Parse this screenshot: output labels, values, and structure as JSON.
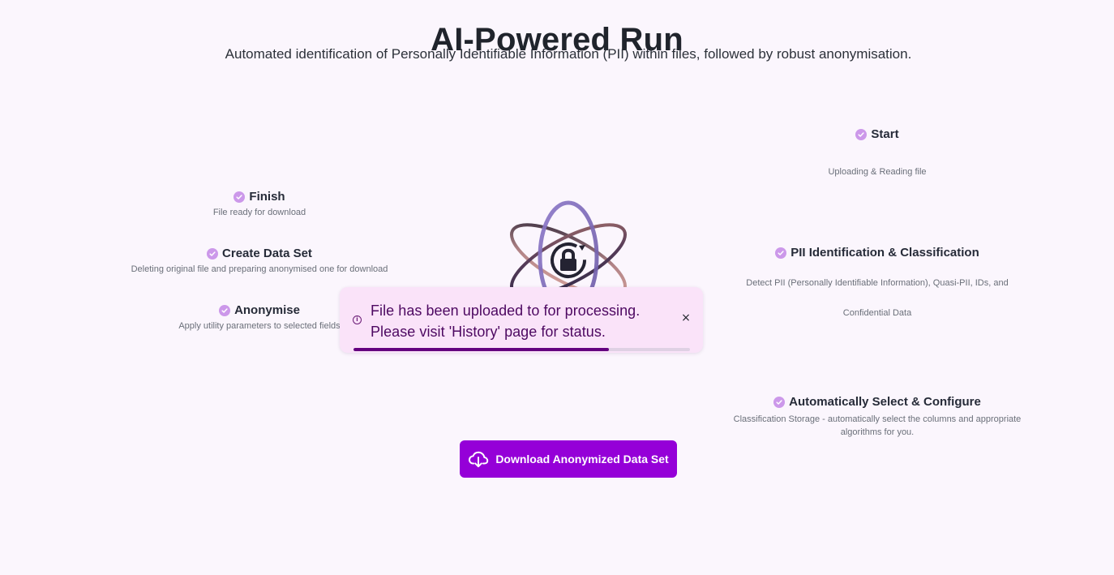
{
  "page": {
    "title": "AI-Powered Run",
    "subtitle": "Automated identification of Personally Identifiable Information (PII) within files, followed by robust anonymisation."
  },
  "steps": {
    "start": {
      "title": "Start",
      "description": "Uploading & Reading file",
      "icon": "check-circle-icon"
    },
    "pii": {
      "title": "PII Identification & Classification",
      "description_line1": "Detect PII (Personally Identifiable Information), Quasi-PII, IDs, and",
      "description_line2": "Confidential Data",
      "icon": "check-circle-icon"
    },
    "configure": {
      "title": "Automatically Select & Configure",
      "description_line1": "Classification Storage - automatically select the columns and appropriate",
      "description_line2": "algorithms for you.",
      "icon": "check-circle-icon"
    },
    "finish": {
      "title": "Finish",
      "description": "File ready for download",
      "icon": "check-circle-icon"
    },
    "create_data_set": {
      "title": "Create Data Set",
      "description": "Deleting original file and preparing anonymised one for download",
      "icon": "check-circle-icon"
    },
    "anonymise": {
      "title": "Anonymise",
      "description": "Apply utility parameters to selected fields",
      "icon": "check-circle-icon"
    }
  },
  "toast": {
    "message": "File has been uploaded to for processing. Please visit 'History' page for status.",
    "close_label": "×",
    "info_icon": "info-icon",
    "progress": 0.76
  },
  "download_button": {
    "label": "Download Anonymized Data Set",
    "icon": "cloud-download-icon"
  },
  "colors": {
    "background": "#fbf6fd",
    "primary": "#9500d8",
    "toast_background": "#fae3f9",
    "toast_text": "#4d0861",
    "check": "#cc98ea",
    "progress_fill": "#64007f",
    "progress_track": "#dfd1e4"
  }
}
